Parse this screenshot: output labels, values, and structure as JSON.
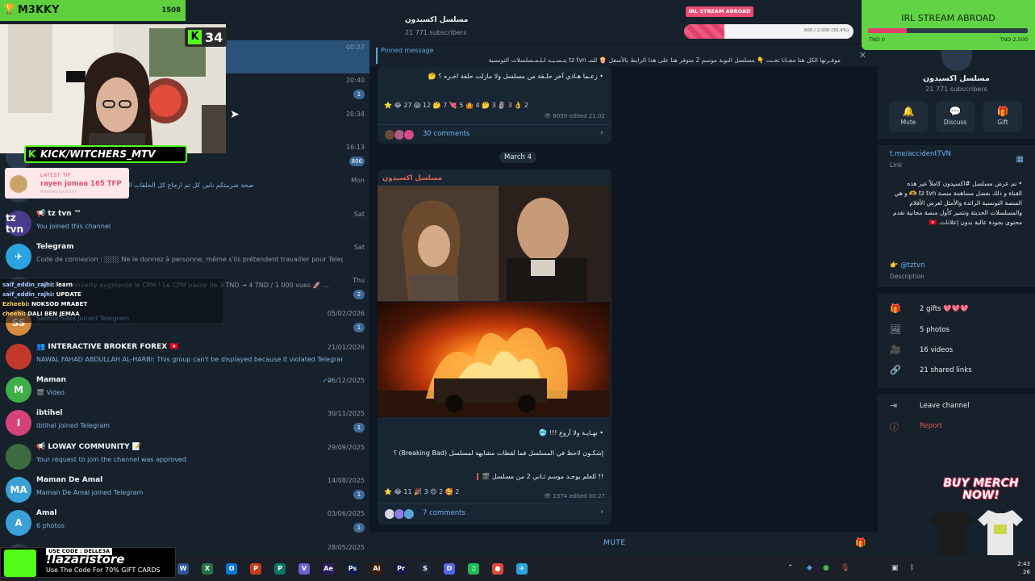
{
  "overlay": {
    "streamer": "M3KKY",
    "count": "1508",
    "kick_count": "34",
    "kick_channel": "KICK/WITCHERS_MTV",
    "tip": {
      "label": "LATEST TIP",
      "text": "rayen jomaa 165 TFP",
      "sub": "Powered by Botrix"
    },
    "chat_lines": [
      {
        "user": "saif_eddin_rajhi",
        "text": "learn"
      },
      {
        "user": "saif_eddin_rajhi",
        "text": "UPDATE"
      },
      {
        "user": "Ezheebi",
        "text": "NOKSOD MRABET"
      },
      {
        "user": "cheebi",
        "text": "DALI BEN JEMAA"
      }
    ],
    "irl_mini": "IRL STREAM ABROAD",
    "irl_bar_value": "600 / 2,500 (30.4%)",
    "irl_bar_fraction": 0.24,
    "irl_card": {
      "title": "IRL STREAM ABROAD",
      "min": "TND 0",
      "max": "TND 2,500",
      "fraction": 0.24
    },
    "merch": "BUY MERCH NOW!",
    "promo": {
      "code": "USE CODE : DELLE3A",
      "name": "!lazaristore",
      "sub": "Use The Code For 70% GIFT CARDS"
    }
  },
  "chatlist": {
    "rows": [
      {
        "name": "",
        "preview": "",
        "date": "00:27",
        "badge": "",
        "avatar": "",
        "color": "#3b6ea5",
        "active": true
      },
      {
        "name": "",
        "preview": "حلقة 13 كـــــامـلة ... وذلك بفضل مسـ",
        "date": "20:40",
        "badge": "1",
        "avatar": "",
        "color": "#2b3a4a"
      },
      {
        "name": "",
        "preview": "الخطيفة حلقة 13 كـــــامـلة و ذلك بفضل مسـ",
        "date": "20:34",
        "badge": "",
        "avatar": "",
        "color": "#2b3a4a"
      },
      {
        "name": "",
        "preview": "أوقات الخدمة: من 8 متاع الصباح لـ 5 متاع العشية",
        "date": "16:13",
        "badge": "806",
        "avatar": "",
        "color": "#2b3a4a"
      },
      {
        "name": "",
        "preview": "صحة شريبتكم ناس كل تم ارجاع كل الحلقات المحذوفة و حـــلقة 12 انشالله تنزل",
        "date": "Mon",
        "badge": "",
        "avatar": "",
        "color": "#2b3a4a"
      },
      {
        "name": "📢 tz tvn ™",
        "preview": "You joined this channel",
        "date": "Sat",
        "badge": "",
        "avatar": "tz tvn",
        "color": "#4a3c8c"
      },
      {
        "name": "Telegram",
        "preview": "Code de connexion : ░░░ Ne le donnez à personne, même s'ils prétendent travailler pour Telegram…",
        "date": "Sat",
        "badge": "",
        "avatar": "✈",
        "color": "#2aa3df",
        "grey": true
      },
      {
        "name": "",
        "preview": "UPDATE : Converty augmente le CPM ! Le CPM passe de 3 TND → 4 TND / 1 000 vues 🚀 …",
        "date": "Thu",
        "badge": "2",
        "avatar": "",
        "color": "#2b3a4a",
        "grey": true
      },
      {
        "name": "",
        "preview": "Salima Siala joined Telegram",
        "date": "05/02/2026",
        "badge": "1",
        "avatar": "SS",
        "color": "#d68a3c"
      },
      {
        "name": "👥 INTERACTIVE BROKER FOREX 🇹🇳",
        "preview": "NAWAL FAHAD ABDULLAH AL-HARBI: This group can't be displayed because it violated Telegram's …",
        "date": "21/01/2026",
        "badge": "",
        "avatar": "",
        "color": "#c0392b"
      },
      {
        "name": "Maman",
        "preview": "🎬 Video",
        "date": "06/12/2025",
        "badge": "",
        "avatar": "M",
        "color": "#3fae49",
        "check": true
      },
      {
        "name": "ibtihel",
        "preview": "ibtihel joined Telegram",
        "date": "30/11/2025",
        "badge": "1",
        "avatar": "I",
        "color": "#d5427a"
      },
      {
        "name": "📢 LOWAY COMMUNITY 📝",
        "preview": "Your request to join the channel was approved",
        "date": "29/09/2025",
        "badge": "",
        "avatar": "",
        "color": "#3c6b3f"
      },
      {
        "name": "Maman De Amal",
        "preview": "Maman De Amal joined Telegram",
        "date": "14/08/2025",
        "badge": "1",
        "avatar": "MA",
        "color": "#3aa0d8"
      },
      {
        "name": "Amal",
        "preview": "6 photos",
        "date": "03/06/2025",
        "badge": "1",
        "avatar": "A",
        "color": "#3aa0d8"
      },
      {
        "name": "",
        "preview": "",
        "date": "28/05/2025",
        "badge": "",
        "avatar": "",
        "color": "#2b3a4a"
      }
    ]
  },
  "channel": {
    "title": "مسلسل اكسيدون",
    "subscribers": "21 771 subscribers",
    "pinned_label": "Pinned message",
    "pinned_text": "موفـرتها الكل هنا مجـانا تحـت 👇 مسلسل النوبة موسم 2 متوفر هنا على هذا الرابط بالأسفل 🍿 للمـ tz tvn يتـسـبـه لـلـمـسلسلات التونسية",
    "msg1_text1": "• زعـما هـاذي آخر حلـقة من مسلسل ولا مازلت حلقة اخـره ؟ 🤔",
    "msg1_reactions": "⭐  😂 27   😱 12   🤔 7   💘 5   🤷 4   🤔 3   🗿 3   👌 2",
    "msg1_views": "👁 6099   edited 21:02",
    "msg1_comments": "30 comments",
    "date_chip": "March 4",
    "msg2_author": "مسلسل اكسيدون",
    "msg2_line1": "• نهـايـة ولا أروع !!! 🥶",
    "msg2_line2": "إشكـون لاحظ في المسلسل فما لقطات مشابهة لمسلسل (Breaking Bad) ؟",
    "msg2_line3": "!! للعلم يوجـد موسم ثـاني 2 من مسلسل 🎬",
    "msg2_reactions": "⭐  😂 11   🎉 3   😍 2   🥰 2",
    "msg2_views": "👁 1374   edited 00:27",
    "msg2_comments": "7 comments",
    "mute": "MUTE"
  },
  "info": {
    "title": "مسلسل اكسيدون",
    "subscribers": "21 771 subscribers",
    "actions": [
      {
        "icon": "🔔",
        "label": "Mute"
      },
      {
        "icon": "💬",
        "label": "Discuss"
      },
      {
        "icon": "🎁",
        "label": "Gift"
      }
    ],
    "link": "t.me/accidentTVN",
    "link_label": "Link",
    "description": "• تم عرض مسلسل #اكسيدون كاملاً عبر هذه القناة و ذلك بفضل مساهمة منصة tz tvn 🫶 و هي المنصة التونسية الرائدة والأمثل لعرض الأفلام والمسلسلات الحديثة وتتميز كأول منصة مجانية تقدم محتوى بجودة عالية بدون إعلانات. 🇹🇳",
    "desc_link": "👉 @tztvn",
    "desc_label": "Description",
    "media": [
      {
        "icon": "🎁",
        "label": "2 gifts 💖💖💖"
      },
      {
        "icon": "🖼",
        "label": "5 photos"
      },
      {
        "icon": "🎥",
        "label": "16 videos"
      },
      {
        "icon": "🔗",
        "label": "21 shared links"
      }
    ],
    "leave": "Leave channel",
    "report": "Report"
  },
  "taskbar": {
    "apps": [
      {
        "label": "W",
        "color": "#2b579a"
      },
      {
        "label": "X",
        "color": "#217346"
      },
      {
        "label": "O",
        "color": "#0078d4"
      },
      {
        "label": "P",
        "color": "#c43e1c"
      },
      {
        "label": "P",
        "color": "#077568"
      },
      {
        "label": "V",
        "color": "#6d5fd6"
      },
      {
        "label": "Ae",
        "color": "#2d1b5c"
      },
      {
        "label": "Ps",
        "color": "#07204a"
      },
      {
        "label": "Ai",
        "color": "#3a1c00"
      },
      {
        "label": "Pr",
        "color": "#1d1544"
      },
      {
        "label": "S",
        "color": "#1b2838"
      },
      {
        "label": "D",
        "color": "#5865f2"
      },
      {
        "label": "♫",
        "color": "#1db954"
      },
      {
        "label": "●",
        "color": "#dd4b39"
      },
      {
        "label": "✈",
        "color": "#2aa3df"
      }
    ],
    "time": "2:43",
    "date": "26"
  }
}
